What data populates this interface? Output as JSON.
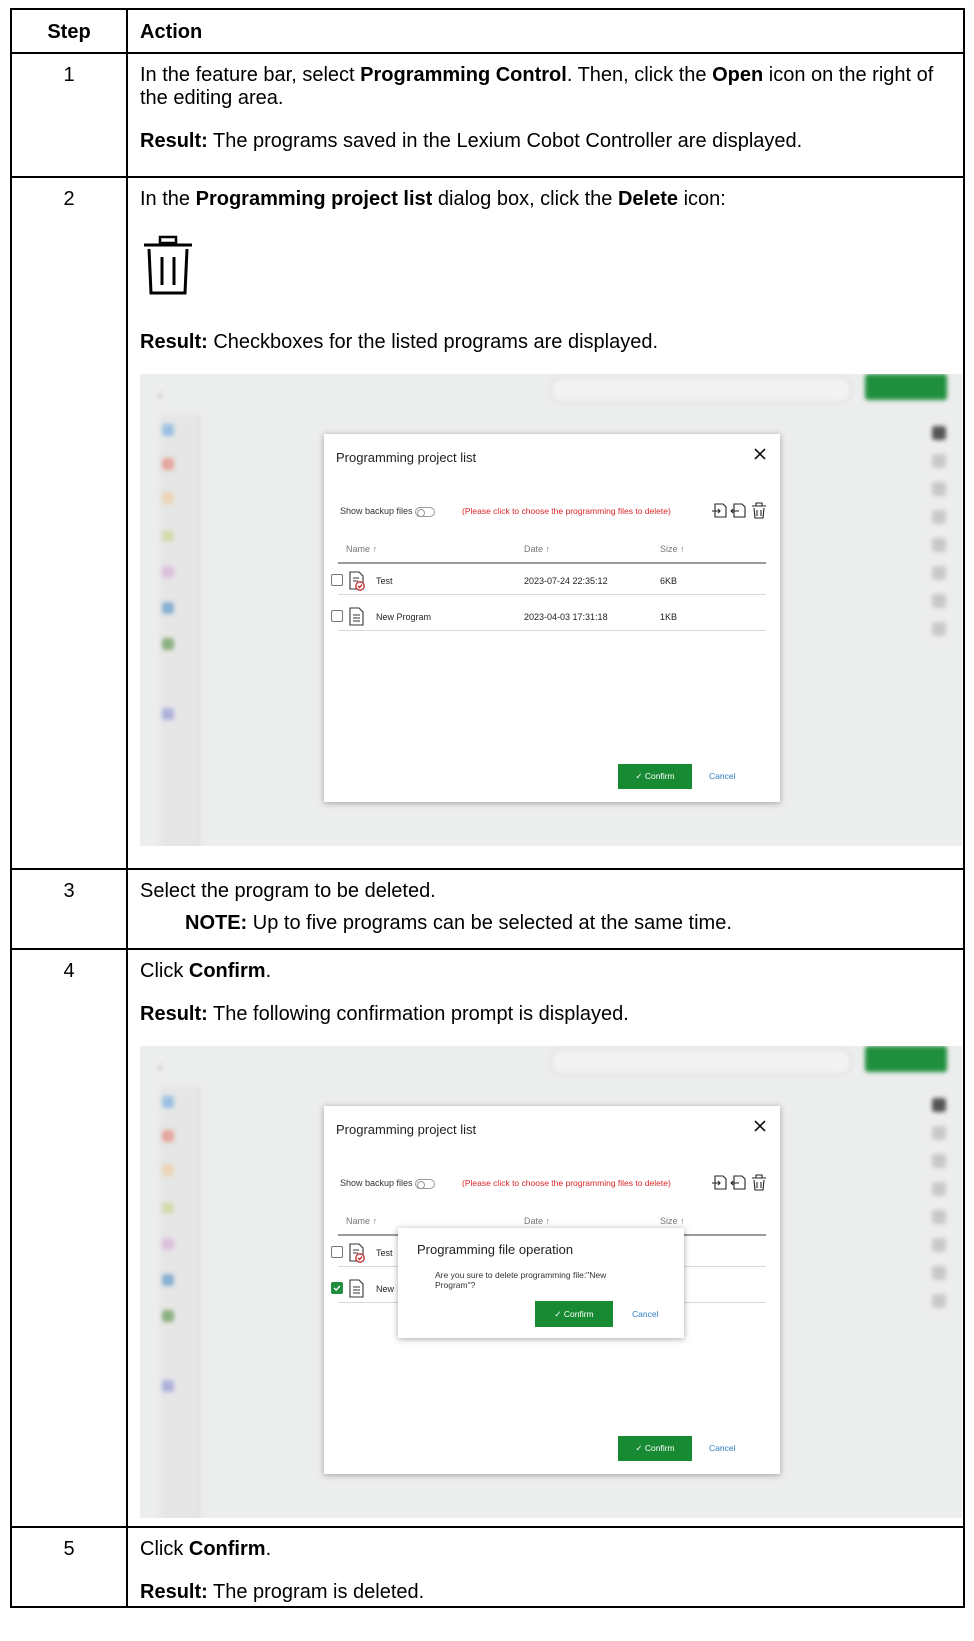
{
  "table": {
    "header": {
      "step": "Step",
      "action": "Action"
    },
    "rows": [
      {
        "step": "1",
        "line1": [
          "In the feature bar, select ",
          "Programming Control",
          ". Then, click the ",
          "Open",
          " icon on the right of the editing area."
        ],
        "result_label": "Result:",
        "result_text": " The programs saved in the Lexium Cobot Controller are displayed."
      },
      {
        "step": "2",
        "line1": [
          "In the ",
          "Programming project list",
          " dialog box, click the ",
          "Delete",
          " icon:"
        ],
        "result_label": "Result:",
        "result_text": " Checkboxes for the listed programs are displayed."
      },
      {
        "step": "3",
        "line1": "Select the program to be deleted.",
        "note_label": "NOTE:",
        "note_text": " Up to five programs can be selected at the same time."
      },
      {
        "step": "4",
        "line1": [
          "Click ",
          "Confirm",
          "."
        ],
        "result_label": "Result:",
        "result_text": " The following confirmation prompt is displayed."
      },
      {
        "step": "5",
        "line1": [
          "Click ",
          "Confirm",
          "."
        ],
        "result_label": "Result:",
        "result_text": " The program is deleted."
      }
    ]
  },
  "dialog": {
    "title": "Programming project list",
    "show_backup": "Show backup files",
    "hint": "(Please click to choose the programming files to delete)",
    "col_name": "Name ↑",
    "col_date": "Date ↑",
    "col_size": "Size ↑",
    "files": [
      {
        "name": "Test",
        "date": "2023-07-24 22:35:12",
        "size": "6KB"
      },
      {
        "name": "New Program",
        "date": "2023-04-03 17:31:18",
        "size": "1KB"
      }
    ],
    "confirm": "✓ Confirm",
    "cancel": "Cancel"
  },
  "popup": {
    "title": "Programming file operation",
    "message": "Are you sure to delete programming file:\"New Program\"?",
    "confirm": "✓ Confirm",
    "cancel": "Cancel",
    "truncated_row": "New"
  },
  "colors": {
    "accent_green": "#188a33",
    "hint_red": "#d9242a",
    "link_blue": "#2b7fc4"
  }
}
